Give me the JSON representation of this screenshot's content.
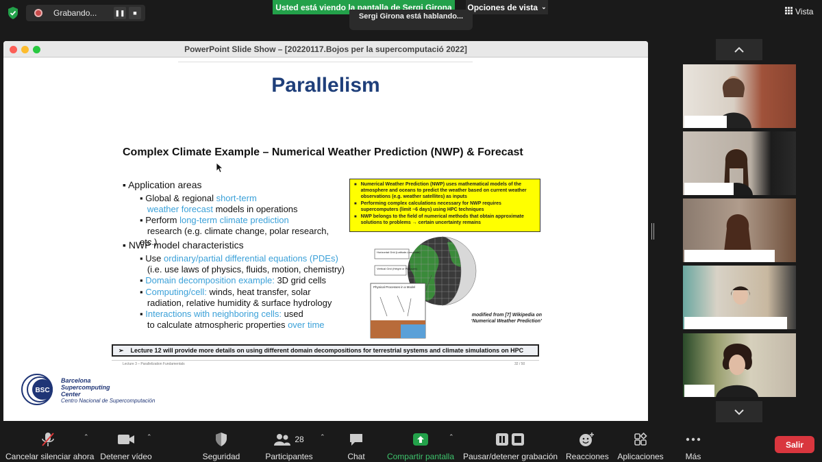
{
  "top": {
    "recording_label": "Grabando...",
    "share_banner": "Usted está viendo la pantalla de Sergi Girona",
    "view_options": "Opciones de vista",
    "speaking": "Sergi Girona está hablando...",
    "view_label": "Vista"
  },
  "window": {
    "title": "PowerPoint Slide Show – [20220117.Bojos per la supercomputació 2022]"
  },
  "slide": {
    "title": "Parallelism",
    "subtitle": "Complex Climate Example – Numerical Weather Prediction (NWP) & Forecast",
    "app_areas": "Application areas",
    "b1_a": "Global & regional ",
    "b1_b": "short-term",
    "b1_c": "weather forecast",
    "b1_d": " models in operations",
    "b2_a": "Perform ",
    "b2_b": "long-term climate prediction",
    "b2_c": "research (e.g. climate change, polar research, etc.)",
    "nwp_chars": "NWP model characteristics",
    "c1_a": "Use ",
    "c1_b": "ordinary/partial differential equations (PDEs)",
    "c1_c": "(i.e. use laws of physics, fluids, motion, chemistry)",
    "c2_a": "Domain decomposition example:",
    "c2_b": " 3D grid cells",
    "c3_a": "Computing/cell:",
    "c3_b": " winds, heat transfer, solar",
    "c3_c": "radiation, relative humidity & surface hydrology",
    "c4_a": "Interactions with neighboring cells:",
    "c4_b": " used",
    "c4_c": "to calculate atmospheric properties ",
    "c4_d": "over time",
    "yellow": [
      "Numerical Weather Prediction (NWP) uses mathematical models of the atmosphere and oceans to predict the weather based on current weather observations (e.g. weather satellites) as inputs",
      "Performing complex calculations necessary for NWP requires supercomputers (limit ~6 days) using HPC techniques",
      "NWP belongs to the field of numerical methods that obtain approximate solutions to problems → certain uncertainty remains"
    ],
    "diagram_labels": {
      "horizontal": "Horizontal Grid (Latitude-Longitude)",
      "vertical": "Vertical Grid (Height or Pressure)",
      "physical": "Physical Processes in a Model"
    },
    "wiki_note_1": "modified from [7] Wikipedia on",
    "wiki_note_2": "‘Numerical Weather Prediction’",
    "note": "Lecture 12 will provide more details on using different domain decompositions for terrestrial systems and climate simulations on HPC",
    "footer_left": "Lecture 3 – Parallelization Fundamentals",
    "footer_right": "32 / 50",
    "bsc_logo": "BSC",
    "bsc_1": "Barcelona",
    "bsc_2": "Supercomputing",
    "bsc_3": "Center",
    "bsc_sub": "Centro Nacional de Supercomputación"
  },
  "toolbar": {
    "unmute": "Cancelar silenciar ahora",
    "stop_video": "Detener vídeo",
    "security": "Seguridad",
    "participants": "Participantes",
    "participants_count": "28",
    "chat": "Chat",
    "share": "Compartir pantalla",
    "pause_rec": "Pausar/detener grabación",
    "reactions": "Reacciones",
    "apps": "Aplicaciones",
    "more": "Más",
    "leave": "Salir"
  },
  "colors": {
    "share_green": "#23a14a",
    "leave_red": "#d9363e",
    "slide_blue": "#3aa0d8",
    "title_navy": "#1f3f7a"
  }
}
